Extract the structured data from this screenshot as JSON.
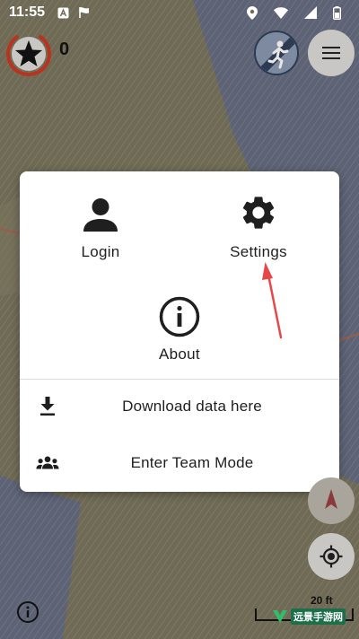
{
  "status_bar": {
    "time": "11:55",
    "icons": [
      "notification-a-icon",
      "flag-icon",
      "location-icon",
      "wifi-icon",
      "signal-icon",
      "battery-icon"
    ]
  },
  "map": {
    "score_value": "0",
    "scale_label": "20 ft",
    "watermark_text": "远景手游网"
  },
  "dialog": {
    "tiles": {
      "login": "Login",
      "settings": "Settings",
      "about": "About"
    },
    "rows": {
      "download": "Download data here",
      "team": "Enter Team Mode"
    }
  },
  "colors": {
    "annotation_arrow": "#e8474a",
    "score_ring": "#b8341f",
    "dialog_bg": "#ffffff",
    "map_base": "#6f6a55"
  }
}
